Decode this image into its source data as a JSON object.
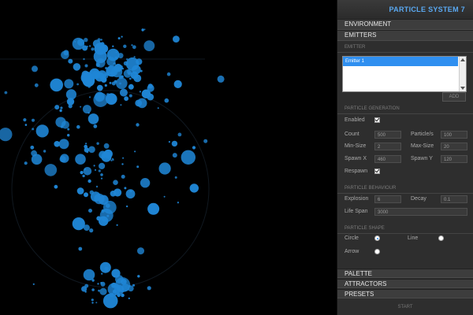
{
  "panel": {
    "title": "PARTICLE SYSTEM 7",
    "sections": {
      "environment": "ENVIRONMENT",
      "emitters": "EMITTERS",
      "palette": "PALETTE",
      "attractors": "ATTRACTORS",
      "presets": "PRESETS"
    },
    "emitter_label": "EMITTER",
    "emitters_list": [
      "Emitter 1"
    ],
    "add_label": "ADD",
    "generation": {
      "title": "PARTICLE GENERATION",
      "enabled_label": "Enabled",
      "enabled": true,
      "count_label": "Count",
      "count": "500",
      "particles_label": "Particle/s",
      "particles": "100",
      "min_size_label": "Min-Size",
      "min_size": "2",
      "max_size_label": "Max-Size",
      "max_size": "20",
      "spawn_x_label": "Spawn X",
      "spawn_x": "460",
      "spawn_y_label": "Spawn Y",
      "spawn_y": "120",
      "respawn_label": "Respawn",
      "respawn": true
    },
    "behaviour": {
      "title": "PARTICLE BEHAVIOUR",
      "explosion_label": "Explosion",
      "explosion": "6",
      "decay_label": "Decay",
      "decay": "0.1",
      "lifespan_label": "Life Span",
      "lifespan": "3000"
    },
    "shape": {
      "title": "PARTICLE SHAPE",
      "options": [
        "Circle",
        "Line",
        "Arrow"
      ],
      "selected": "Circle"
    },
    "start_label": "START"
  },
  "colors": {
    "particle": "#1f86d6",
    "accent": "#5aa9f2"
  }
}
